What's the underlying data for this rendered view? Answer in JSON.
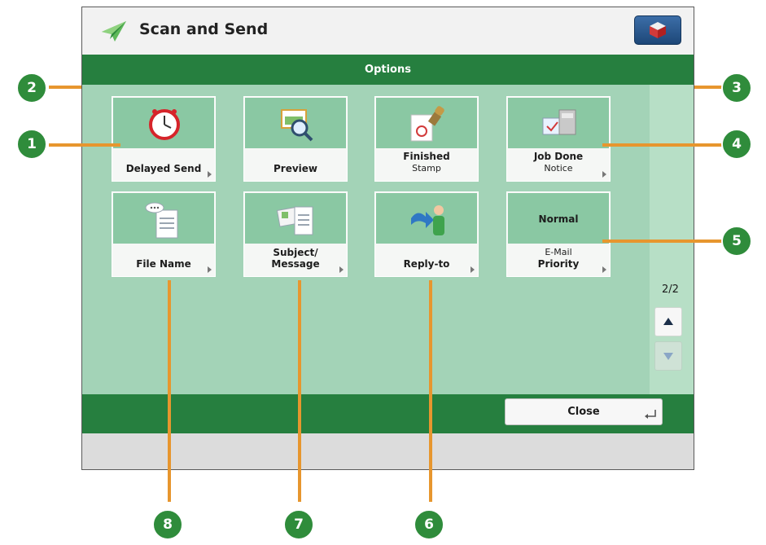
{
  "app": {
    "title": "Scan and Send"
  },
  "options_bar": {
    "title": "Options"
  },
  "tiles": [
    {
      "label": "Delayed Send",
      "label2": ""
    },
    {
      "label": "Preview",
      "label2": ""
    },
    {
      "label": "Finished",
      "label2": "Stamp"
    },
    {
      "label": "Job Done",
      "label2": "Notice"
    },
    {
      "label": "File Name",
      "label2": ""
    },
    {
      "label": "Subject/",
      "label2": "Message"
    },
    {
      "label": "Reply-to",
      "label2": ""
    },
    {
      "label": "E-Mail",
      "label2": "Priority",
      "value": "Normal"
    }
  ],
  "pager": {
    "indicator": "2/2"
  },
  "close_button": {
    "label": "Close"
  },
  "callouts": [
    "1",
    "2",
    "3",
    "4",
    "5",
    "6",
    "7",
    "8"
  ],
  "colors": {
    "accent_green": "#267f3f",
    "callout_orange": "#e7962e",
    "badge_green": "#2f8c3b"
  },
  "icons": [
    "plane-icon",
    "home-icon",
    "clock-icon",
    "magnifier-icon",
    "stamp-icon",
    "job-done-icon",
    "file-name-icon",
    "message-icon",
    "reply-to-icon",
    "up-arrow-icon",
    "down-arrow-icon",
    "enter-icon"
  ]
}
